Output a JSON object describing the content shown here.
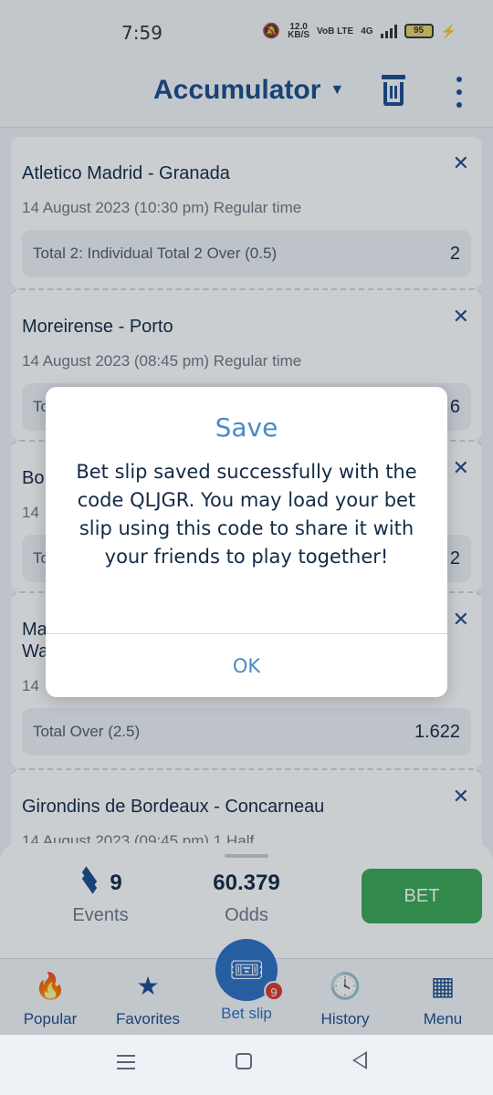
{
  "status_bar": {
    "time": "7:59",
    "speed_value": "12.0",
    "speed_unit": "KB/S",
    "network": "VoB LTE",
    "network_gen": "4G",
    "battery": "95"
  },
  "header": {
    "title": "Accumulator"
  },
  "bets": [
    {
      "match": "Atletico Madrid - Granada",
      "time": "14 August 2023 (10:30 pm) Regular time",
      "market": "Total 2: Individual Total 2 Over (0.5)",
      "odd": "2"
    },
    {
      "match": "Moreirense - Porto",
      "time": "14 August 2023 (08:45 pm) Regular time",
      "market": "To",
      "odd": "6"
    },
    {
      "match": "Bo",
      "time": "14",
      "market": "To",
      "odd": "2"
    },
    {
      "match": "Ma Wa",
      "time": "14",
      "market": "Total Over (2.5)",
      "odd": "1.622"
    },
    {
      "match": "Girondins de Bordeaux - Concarneau",
      "time": "14 August 2023 (09:45 pm) 1 Half",
      "market": "",
      "odd": ""
    }
  ],
  "summary": {
    "events_count": "9",
    "events_label": "Events",
    "odds_value": "60.379",
    "odds_label": "Odds",
    "bet_label": "BET"
  },
  "nav": {
    "popular": "Popular",
    "favorites": "Favorites",
    "bet_slip": "Bet slip",
    "bet_slip_badge": "9",
    "history": "History",
    "menu": "Menu"
  },
  "modal": {
    "title": "Save",
    "message": "Bet slip saved successfully with the code QLJGR. You may load your bet slip using this code to share it with your friends to play together!",
    "ok_label": "OK"
  },
  "colors": {
    "primary": "#1b4c8c",
    "accent": "#4a8ac8",
    "bet_green": "#3aa854",
    "badge_red": "#d93a2b"
  }
}
